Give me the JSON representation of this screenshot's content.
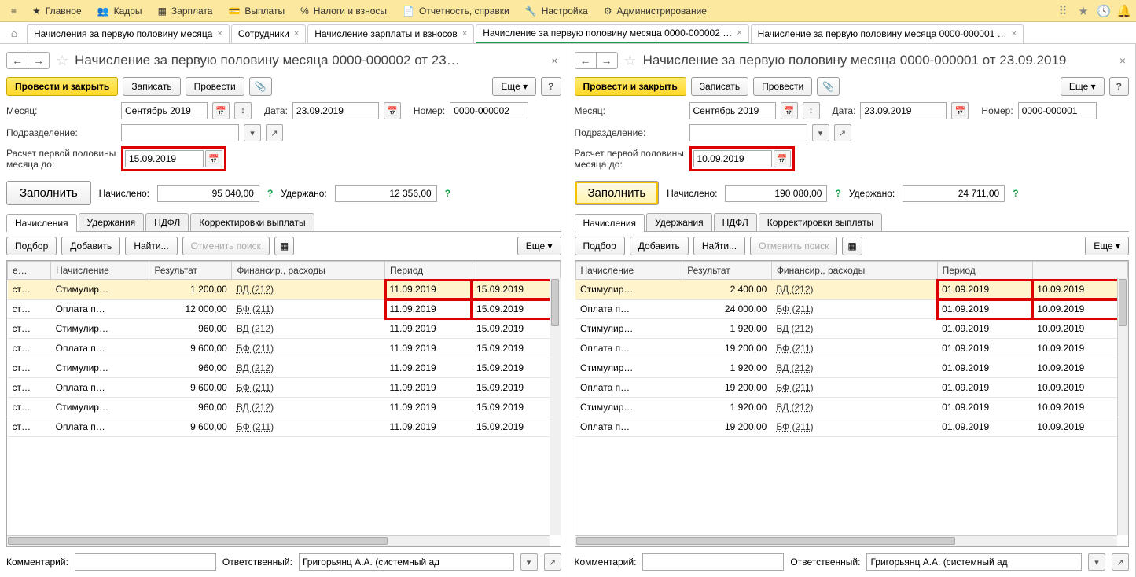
{
  "topmenu": {
    "items": [
      {
        "label": "Главное"
      },
      {
        "label": "Кадры"
      },
      {
        "label": "Зарплата"
      },
      {
        "label": "Выплаты"
      },
      {
        "label": "Налоги и взносы"
      },
      {
        "label": "Отчетность, справки"
      },
      {
        "label": "Настройка"
      },
      {
        "label": "Администрирование"
      }
    ]
  },
  "tabs": [
    {
      "label": "Начисления за первую половину месяца"
    },
    {
      "label": "Сотрудники"
    },
    {
      "label": "Начисление зарплаты и взносов"
    },
    {
      "label": "Начисление за первую половину месяца 0000-000002 …",
      "active": true
    },
    {
      "label": "Начисление за первую половину месяца 0000-000001 …"
    }
  ],
  "panels": [
    {
      "title": "Начисление за первую половину месяца 0000-000002 от 23…",
      "buttons": {
        "post_close": "Провести и закрыть",
        "write": "Записать",
        "post": "Провести",
        "more": "Еще"
      },
      "month_label": "Месяц:",
      "month": "Сентябрь 2019",
      "date_label": "Дата:",
      "date": "23.09.2019",
      "number_label": "Номер:",
      "number": "0000-000002",
      "dept_label": "Подразделение:",
      "dept": "",
      "calc_label": "Расчет первой половины месяца до:",
      "calc_date": "15.09.2019",
      "fill": "Заполнить",
      "fill_selected": false,
      "accrued_label": "Начислено:",
      "accrued": "95 040,00",
      "withheld_label": "Удержано:",
      "withheld": "12 356,00",
      "subtabs": [
        "Начисления",
        "Удержания",
        "НДФЛ",
        "Корректировки выплаты"
      ],
      "tt": {
        "pick": "Подбор",
        "add": "Добавить",
        "find": "Найти...",
        "cancel": "Отменить поиск",
        "more": "Еще"
      },
      "cols": [
        "е…",
        "Начисление",
        "Результат",
        "Финансир., расходы",
        "Период",
        ""
      ],
      "rows": [
        {
          "c": "ст…",
          "n": "Стимулир…",
          "r": "1 200,00",
          "f": "ВД (212)",
          "p1": "11.09.2019",
          "p2": "15.09.2019",
          "sel": true,
          "hl": true
        },
        {
          "c": "ст…",
          "n": "Оплата п…",
          "r": "12 000,00",
          "f": "БФ (211)",
          "p1": "11.09.2019",
          "p2": "15.09.2019",
          "hl": true
        },
        {
          "c": "ст…",
          "n": "Стимулир…",
          "r": "960,00",
          "f": "ВД (212)",
          "p1": "11.09.2019",
          "p2": "15.09.2019"
        },
        {
          "c": "ст…",
          "n": "Оплата п…",
          "r": "9 600,00",
          "f": "БФ (211)",
          "p1": "11.09.2019",
          "p2": "15.09.2019"
        },
        {
          "c": "ст…",
          "n": "Стимулир…",
          "r": "960,00",
          "f": "ВД (212)",
          "p1": "11.09.2019",
          "p2": "15.09.2019"
        },
        {
          "c": "ст…",
          "n": "Оплата п…",
          "r": "9 600,00",
          "f": "БФ (211)",
          "p1": "11.09.2019",
          "p2": "15.09.2019"
        },
        {
          "c": "ст…",
          "n": "Стимулир…",
          "r": "960,00",
          "f": "ВД (212)",
          "p1": "11.09.2019",
          "p2": "15.09.2019"
        },
        {
          "c": "ст…",
          "n": "Оплата п…",
          "r": "9 600,00",
          "f": "БФ (211)",
          "p1": "11.09.2019",
          "p2": "15.09.2019"
        }
      ],
      "comment_label": "Комментарий:",
      "comment": "",
      "resp_label": "Ответственный:",
      "resp": "Григорьянц А.А. (системный ад"
    },
    {
      "title": "Начисление за первую половину месяца 0000-000001 от 23.09.2019",
      "buttons": {
        "post_close": "Провести и закрыть",
        "write": "Записать",
        "post": "Провести",
        "more": "Еще"
      },
      "month_label": "Месяц:",
      "month": "Сентябрь 2019",
      "date_label": "Дата:",
      "date": "23.09.2019",
      "number_label": "Номер:",
      "number": "0000-000001",
      "dept_label": "Подразделение:",
      "dept": "",
      "calc_label": "Расчет первой половины месяца до:",
      "calc_date": "10.09.2019",
      "fill": "Заполнить",
      "fill_selected": true,
      "accrued_label": "Начислено:",
      "accrued": "190 080,00",
      "withheld_label": "Удержано:",
      "withheld": "24 711,00",
      "subtabs": [
        "Начисления",
        "Удержания",
        "НДФЛ",
        "Корректировки выплаты"
      ],
      "tt": {
        "pick": "Подбор",
        "add": "Добавить",
        "find": "Найти...",
        "cancel": "Отменить поиск",
        "more": "Еще"
      },
      "cols": [
        "Начисление",
        "Результат",
        "Финансир., расходы",
        "Период",
        ""
      ],
      "rows": [
        {
          "n": "Стимулир…",
          "r": "2 400,00",
          "f": "ВД (212)",
          "p1": "01.09.2019",
          "p2": "10.09.2019",
          "sel": true,
          "hl": true
        },
        {
          "n": "Оплата п…",
          "r": "24 000,00",
          "f": "БФ (211)",
          "p1": "01.09.2019",
          "p2": "10.09.2019",
          "hl": true
        },
        {
          "n": "Стимулир…",
          "r": "1 920,00",
          "f": "ВД (212)",
          "p1": "01.09.2019",
          "p2": "10.09.2019"
        },
        {
          "n": "Оплата п…",
          "r": "19 200,00",
          "f": "БФ (211)",
          "p1": "01.09.2019",
          "p2": "10.09.2019"
        },
        {
          "n": "Стимулир…",
          "r": "1 920,00",
          "f": "ВД (212)",
          "p1": "01.09.2019",
          "p2": "10.09.2019"
        },
        {
          "n": "Оплата п…",
          "r": "19 200,00",
          "f": "БФ (211)",
          "p1": "01.09.2019",
          "p2": "10.09.2019"
        },
        {
          "n": "Стимулир…",
          "r": "1 920,00",
          "f": "ВД (212)",
          "p1": "01.09.2019",
          "p2": "10.09.2019"
        },
        {
          "n": "Оплата п…",
          "r": "19 200,00",
          "f": "БФ (211)",
          "p1": "01.09.2019",
          "p2": "10.09.2019"
        }
      ],
      "comment_label": "Комментарий:",
      "comment": "",
      "resp_label": "Ответственный:",
      "resp": "Григорьянц А.А. (системный ад"
    }
  ]
}
